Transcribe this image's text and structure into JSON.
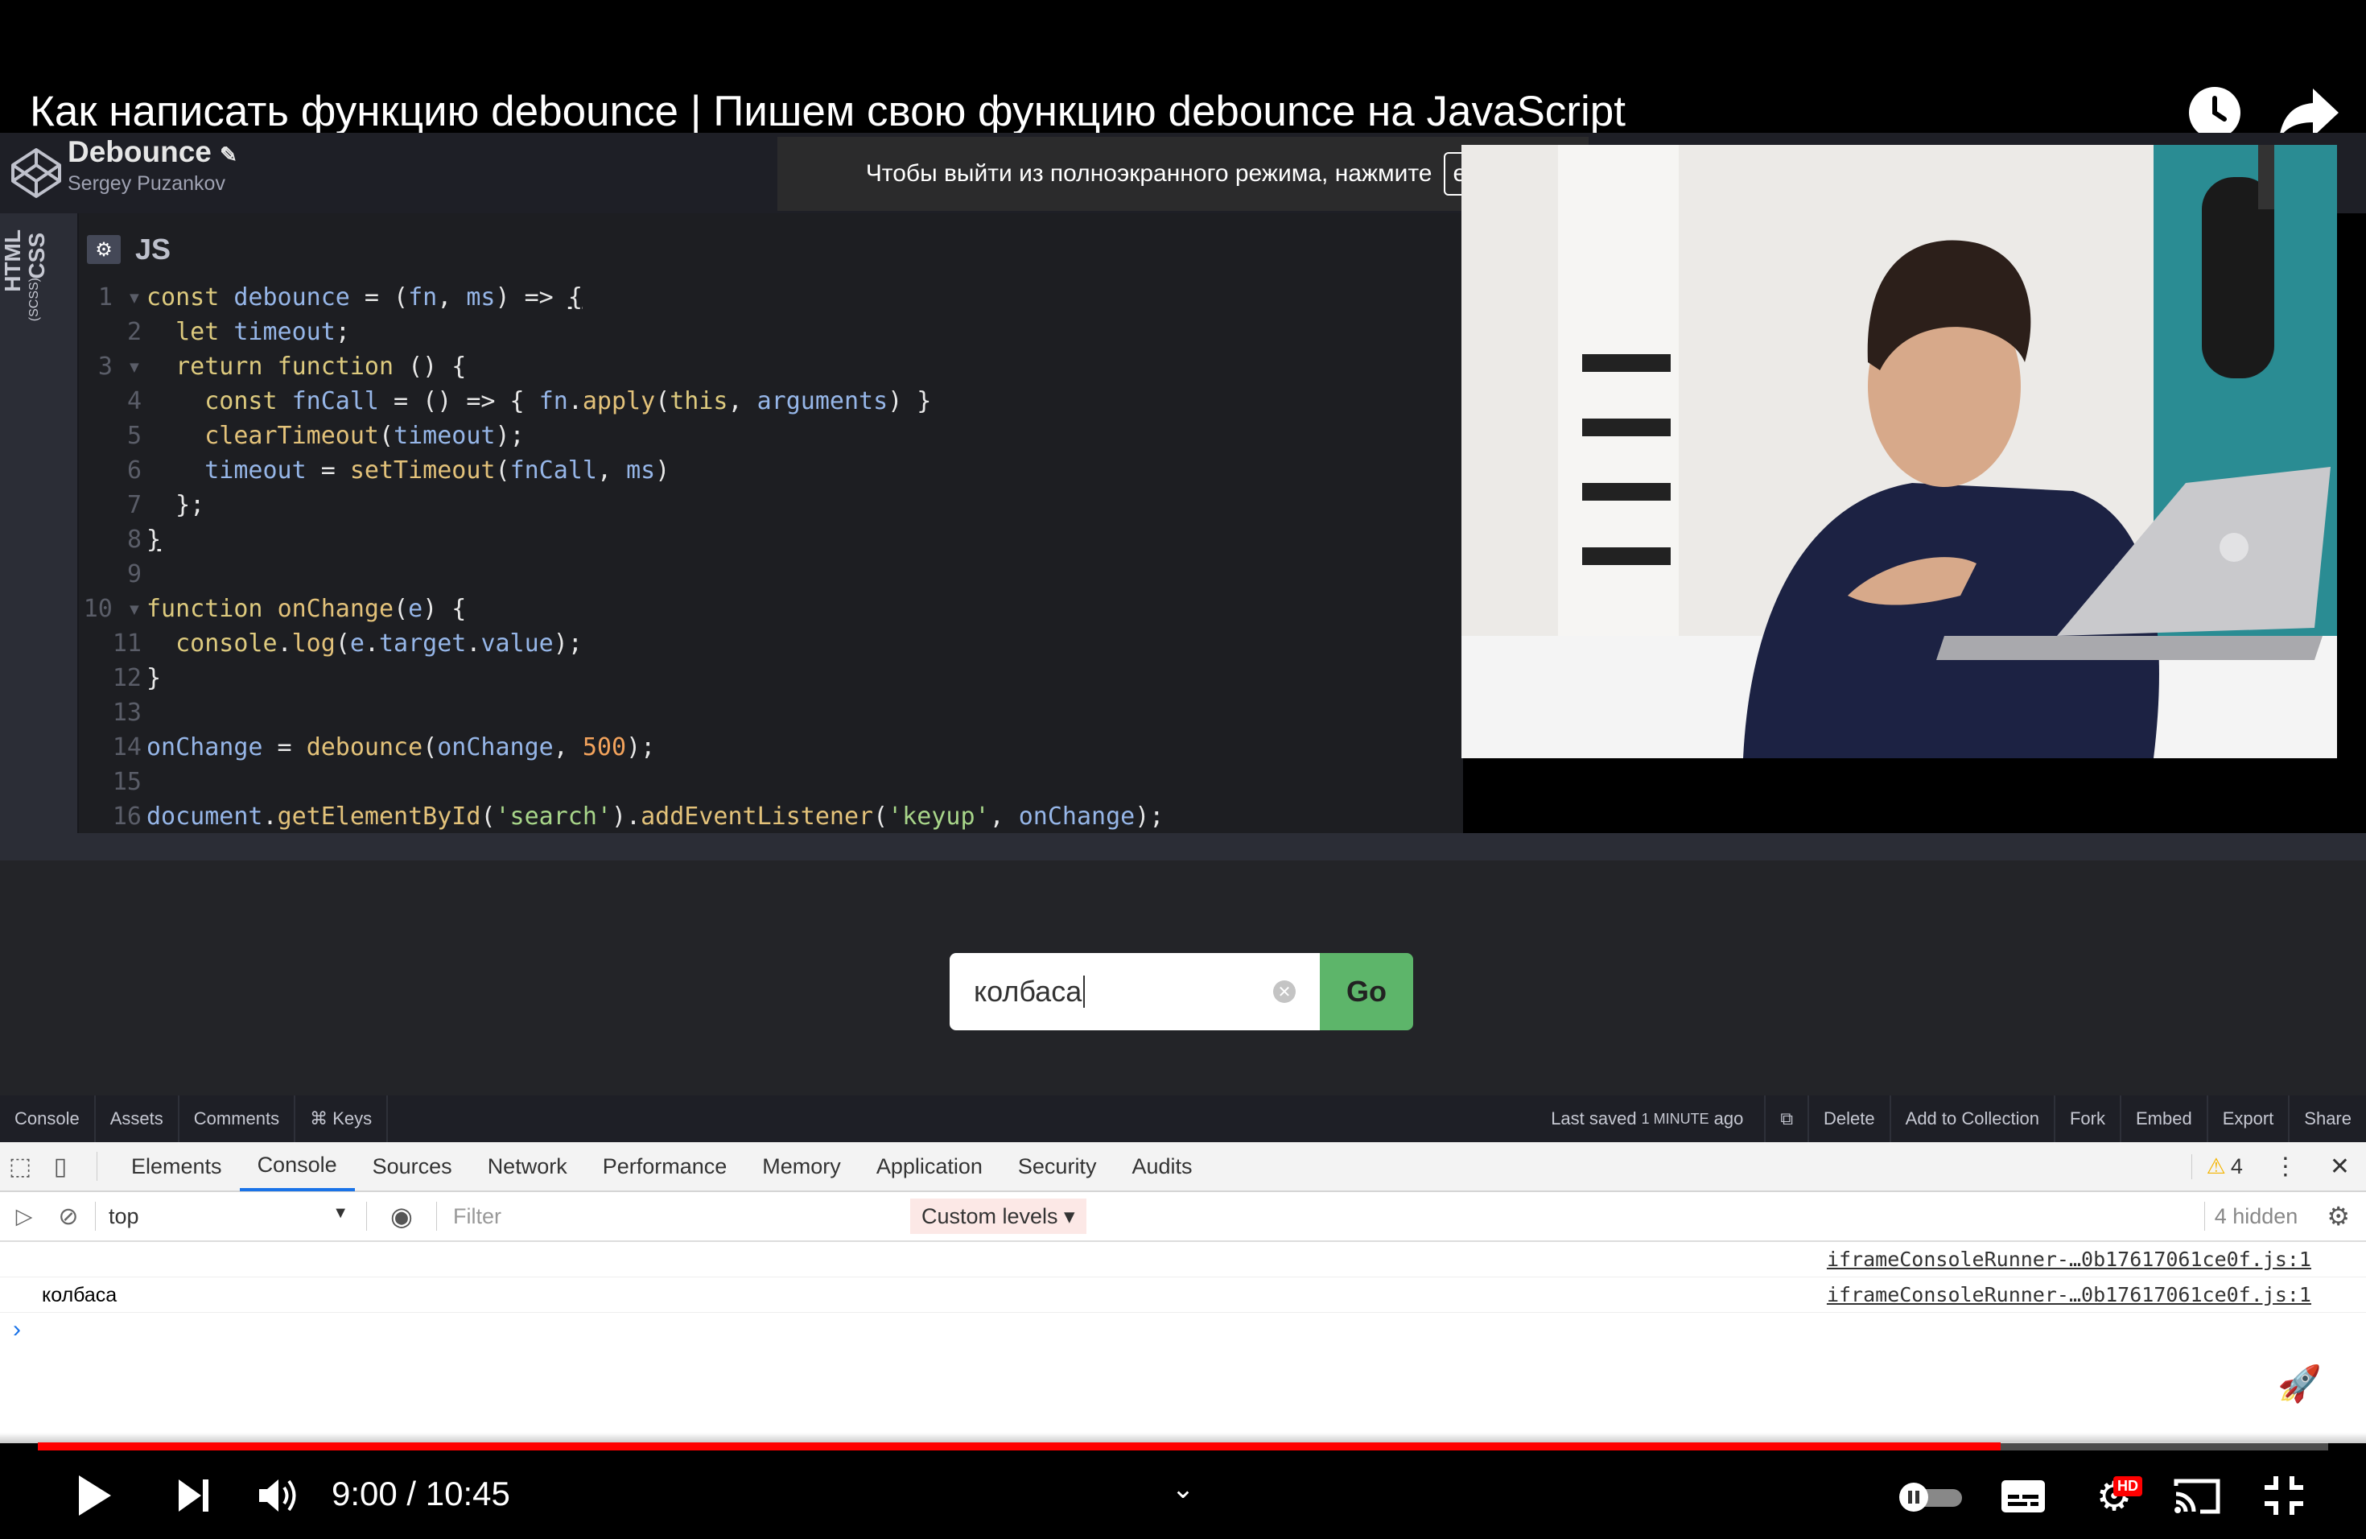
{
  "video": {
    "title": "Как написать функцию debounce | Пишем свою функцию debounce на JavaScript",
    "fullscreen_hint": "Чтобы выйти из полноэкранного режима, нажмите",
    "fullscreen_key": "esc",
    "time_display": "9:00 / 10:45",
    "progress_fraction": 0.857,
    "quality_badge": "HD"
  },
  "codepen": {
    "pen_title": "Debounce",
    "author": "Sergey Puzankov",
    "side_tabs": {
      "html": "HTML",
      "css": "CSS",
      "scss": "(SCSS)"
    },
    "editor_label": "JS",
    "line_numbers": [
      "1",
      "2",
      "3",
      "4",
      "5",
      "6",
      "7",
      "8",
      "9",
      "10",
      "11",
      "12",
      "13",
      "14",
      "15",
      "16"
    ],
    "search_value": "колбаса",
    "go_label": "Go",
    "footer_left": [
      "Console",
      "Assets",
      "Comments",
      "⌘ Keys"
    ],
    "last_saved_prefix": "Last saved",
    "last_saved_time": "1 MINUTE",
    "last_saved_suffix": "ago",
    "footer_right": [
      "Delete",
      "Add to Collection",
      "Fork",
      "Embed",
      "Export",
      "Share"
    ]
  },
  "devtools": {
    "tabs": [
      "Elements",
      "Console",
      "Sources",
      "Network",
      "Performance",
      "Memory",
      "Application",
      "Security",
      "Audits"
    ],
    "active_tab": "Console",
    "warning_count": "4",
    "context": "top",
    "filter_placeholder": "Filter",
    "levels": "Custom levels ▾",
    "hidden": "4 hidden",
    "rows": [
      {
        "message": "",
        "source": "iframeConsoleRunner-…0b17617061ce0f.js:1"
      },
      {
        "message": "колбаса",
        "source": "iframeConsoleRunner-…0b17617061ce0f.js:1"
      }
    ],
    "prompt": "›"
  },
  "colors": {
    "accent": "#ff0000",
    "go": "#5db56a",
    "devtools_active": "#1a73e8"
  }
}
